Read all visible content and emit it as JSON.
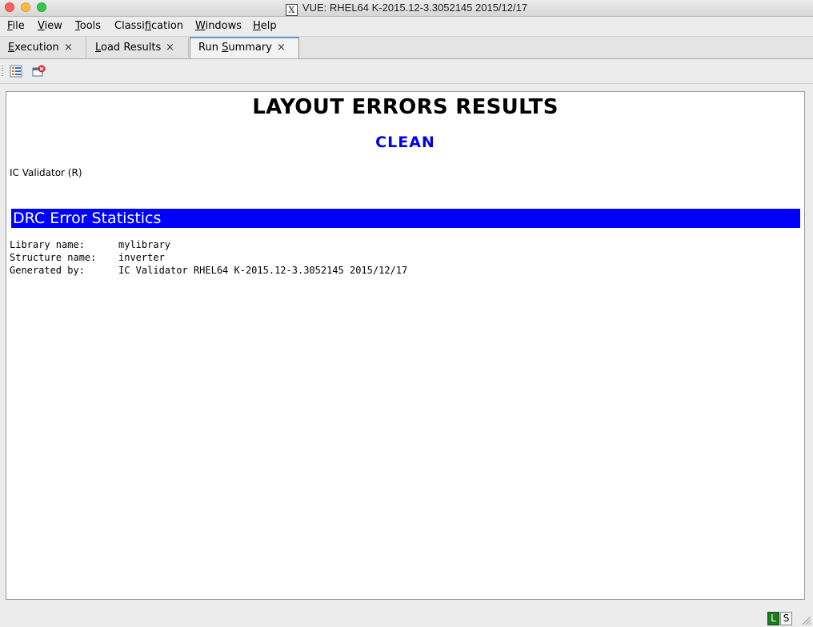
{
  "window": {
    "title": "VUE:  RHEL64 K-2015.12-3.3052145 2015/12/17",
    "app_icon": "X"
  },
  "menu": {
    "items": [
      {
        "first": "F",
        "rest": "ile"
      },
      {
        "first": "V",
        "rest": "iew"
      },
      {
        "first": "T",
        "rest": "ools"
      },
      {
        "pre": "Classi",
        "first": "f",
        "rest": "ication"
      },
      {
        "first": "W",
        "rest": "indows"
      },
      {
        "first": "H",
        "rest": "elp"
      }
    ]
  },
  "tabs": [
    {
      "label_pre": "",
      "label_u": "E",
      "label_rest": "xecution",
      "close": "×",
      "active": false
    },
    {
      "label_pre": "",
      "label_u": "L",
      "label_rest": "oad Results",
      "close": "×",
      "active": false
    },
    {
      "label_pre": "Run ",
      "label_u": "S",
      "label_rest": "ummary",
      "close": "×",
      "active": true
    }
  ],
  "toolbar": {
    "icons": [
      "list-view-icon",
      "close-report-icon"
    ]
  },
  "report": {
    "title": "LAYOUT ERRORS RESULTS",
    "status": "CLEAN",
    "tool": "IC Validator (R)",
    "section": "DRC Error Statistics",
    "fields": [
      {
        "key": "Library name:",
        "value": "mylibrary"
      },
      {
        "key": "Structure name:",
        "value": "inverter"
      },
      {
        "key": "Generated by:",
        "value": "IC Validator RHEL64 K-2015.12-3.3052145 2015/12/17"
      }
    ]
  },
  "statusbar": {
    "l": "L",
    "s": "S"
  },
  "colors": {
    "status": "#0000ee",
    "section_bg": "#0000ff",
    "l_indicator": "#1c7a1c"
  }
}
